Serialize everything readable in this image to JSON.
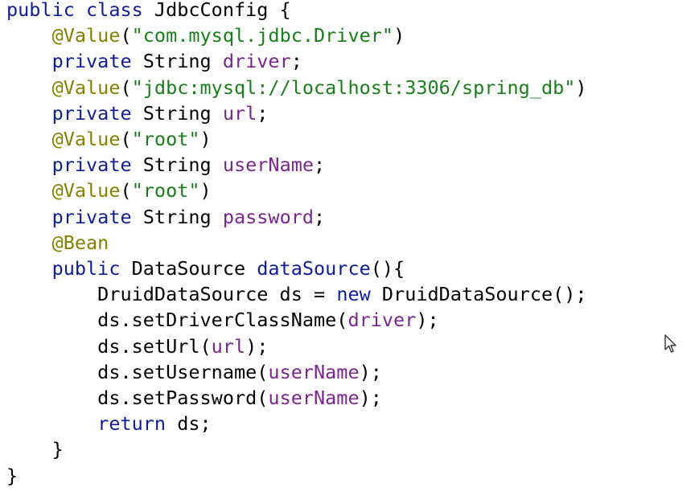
{
  "editor": {
    "language": "Java",
    "lines": [
      [
        {
          "t": "public class",
          "c": "kw"
        },
        {
          "t": " JdbcConfig {",
          "c": "pun"
        }
      ],
      [
        {
          "t": "    ",
          "c": "pun"
        },
        {
          "t": "@Value",
          "c": "ann"
        },
        {
          "t": "(",
          "c": "pun"
        },
        {
          "t": "\"com.mysql.jdbc.Driver\"",
          "c": "str"
        },
        {
          "t": ")",
          "c": "pun"
        }
      ],
      [
        {
          "t": "    ",
          "c": "pun"
        },
        {
          "t": "private",
          "c": "kw"
        },
        {
          "t": " String ",
          "c": "pun"
        },
        {
          "t": "driver",
          "c": "fld"
        },
        {
          "t": ";",
          "c": "pun"
        }
      ],
      [
        {
          "t": "    ",
          "c": "pun"
        },
        {
          "t": "@Value",
          "c": "ann"
        },
        {
          "t": "(",
          "c": "pun"
        },
        {
          "t": "\"jdbc:mysql://localhost:3306/spring_db\"",
          "c": "str"
        },
        {
          "t": ")",
          "c": "pun"
        }
      ],
      [
        {
          "t": "    ",
          "c": "pun"
        },
        {
          "t": "private",
          "c": "kw"
        },
        {
          "t": " String ",
          "c": "pun"
        },
        {
          "t": "url",
          "c": "fld"
        },
        {
          "t": ";",
          "c": "pun"
        }
      ],
      [
        {
          "t": "    ",
          "c": "pun"
        },
        {
          "t": "@Value",
          "c": "ann"
        },
        {
          "t": "(",
          "c": "pun"
        },
        {
          "t": "\"root\"",
          "c": "str"
        },
        {
          "t": ")",
          "c": "pun"
        }
      ],
      [
        {
          "t": "    ",
          "c": "pun"
        },
        {
          "t": "private",
          "c": "kw"
        },
        {
          "t": " String ",
          "c": "pun"
        },
        {
          "t": "userName",
          "c": "fld"
        },
        {
          "t": ";",
          "c": "pun"
        }
      ],
      [
        {
          "t": "    ",
          "c": "pun"
        },
        {
          "t": "@Value",
          "c": "ann"
        },
        {
          "t": "(",
          "c": "pun"
        },
        {
          "t": "\"root\"",
          "c": "str"
        },
        {
          "t": ")",
          "c": "pun"
        }
      ],
      [
        {
          "t": "    ",
          "c": "pun"
        },
        {
          "t": "private",
          "c": "kw"
        },
        {
          "t": " String ",
          "c": "pun"
        },
        {
          "t": "password",
          "c": "fld"
        },
        {
          "t": ";",
          "c": "pun"
        }
      ],
      [
        {
          "t": "    ",
          "c": "pun"
        },
        {
          "t": "@Bean",
          "c": "ann"
        }
      ],
      [
        {
          "t": "    ",
          "c": "pun"
        },
        {
          "t": "public",
          "c": "kw"
        },
        {
          "t": " DataSource ",
          "c": "pun"
        },
        {
          "t": "dataSource",
          "c": "kw"
        },
        {
          "t": "(){",
          "c": "pun"
        }
      ],
      [
        {
          "t": "        DruidDataSource ds = ",
          "c": "pun"
        },
        {
          "t": "new",
          "c": "kw"
        },
        {
          "t": " DruidDataSource();",
          "c": "pun"
        }
      ],
      [
        {
          "t": "        ds.setDriverClassName(",
          "c": "pun"
        },
        {
          "t": "driver",
          "c": "fld"
        },
        {
          "t": ");",
          "c": "pun"
        }
      ],
      [
        {
          "t": "        ds.setUrl(",
          "c": "pun"
        },
        {
          "t": "url",
          "c": "fld"
        },
        {
          "t": ");",
          "c": "pun"
        }
      ],
      [
        {
          "t": "        ds.setUsername(",
          "c": "pun"
        },
        {
          "t": "userName",
          "c": "fld"
        },
        {
          "t": ");",
          "c": "pun"
        }
      ],
      [
        {
          "t": "        ds.setPassword(",
          "c": "pun"
        },
        {
          "t": "userName",
          "c": "fld"
        },
        {
          "t": ");",
          "c": "pun"
        }
      ],
      [
        {
          "t": "        ",
          "c": "pun"
        },
        {
          "t": "return",
          "c": "kw"
        },
        {
          "t": " ds;",
          "c": "pun"
        }
      ],
      [
        {
          "t": "    }",
          "c": "pun"
        }
      ],
      [
        {
          "t": "}",
          "c": "pun"
        }
      ]
    ]
  },
  "colors": {
    "background": "#ffffff",
    "keyword": "#0f1d9a",
    "annotation": "#838200",
    "string": "#1a7f1a",
    "field": "#7a2690",
    "plain": "#000000"
  },
  "cursor_icon": "mouse-pointer-icon"
}
